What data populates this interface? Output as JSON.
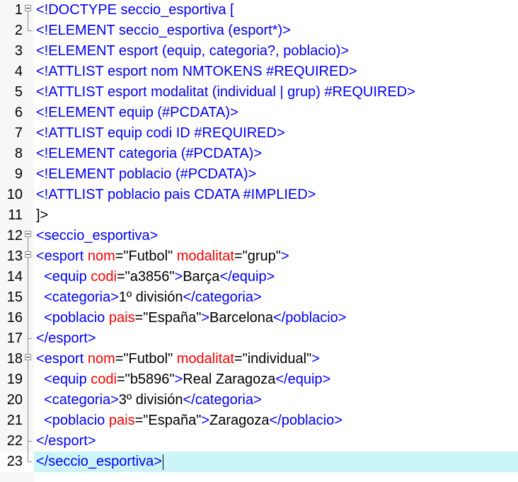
{
  "editor": {
    "current_line": 23,
    "lines": [
      {
        "num": "1",
        "fold": "box",
        "tokens": [
          [
            "tag",
            "<!DOCTYPE seccio_esportiva ["
          ]
        ]
      },
      {
        "num": "2",
        "fold": "end",
        "tokens": [
          [
            "tag",
            "<!ELEMENT seccio_esportiva (esport*)>"
          ]
        ]
      },
      {
        "num": "3",
        "fold": "",
        "tokens": [
          [
            "tag",
            "<!ELEMENT esport (equip, categoria?, poblacio)>"
          ]
        ]
      },
      {
        "num": "4",
        "fold": "",
        "tokens": [
          [
            "tag",
            "<!ATTLIST esport nom NMTOKENS #REQUIRED>"
          ]
        ]
      },
      {
        "num": "5",
        "fold": "",
        "tokens": [
          [
            "tag",
            "<!ATTLIST esport modalitat (individual | grup) #REQUIRED>"
          ]
        ]
      },
      {
        "num": "6",
        "fold": "",
        "tokens": [
          [
            "tag",
            "<!ELEMENT equip (#PCDATA)>"
          ]
        ]
      },
      {
        "num": "7",
        "fold": "",
        "tokens": [
          [
            "tag",
            "<!ATTLIST equip codi ID #REQUIRED>"
          ]
        ]
      },
      {
        "num": "8",
        "fold": "",
        "tokens": [
          [
            "tag",
            "<!ELEMENT categoria (#PCDATA)>"
          ]
        ]
      },
      {
        "num": "9",
        "fold": "",
        "tokens": [
          [
            "tag",
            "<!ELEMENT poblacio (#PCDATA)>"
          ]
        ]
      },
      {
        "num": "10",
        "fold": "",
        "tokens": [
          [
            "tag",
            "<!ATTLIST poblacio pais CDATA #IMPLIED>"
          ]
        ]
      },
      {
        "num": "11",
        "fold": "",
        "tokens": [
          [
            "text",
            "]>"
          ]
        ]
      },
      {
        "num": "12",
        "fold": "box",
        "tokens": [
          [
            "tag",
            "<seccio_esportiva>"
          ]
        ]
      },
      {
        "num": "13",
        "fold": "box",
        "tokens": [
          [
            "tag",
            "<esport "
          ],
          [
            "attr",
            "nom"
          ],
          [
            "val",
            "=\"Futbol\" "
          ],
          [
            "attr",
            "modalitat"
          ],
          [
            "val",
            "=\"grup\""
          ],
          [
            "tag",
            ">"
          ]
        ]
      },
      {
        "num": "14",
        "fold": "mid",
        "tokens": [
          [
            "text",
            "  "
          ],
          [
            "tag",
            "<equip "
          ],
          [
            "attr",
            "codi"
          ],
          [
            "val",
            "=\"a3856\""
          ],
          [
            "tag",
            ">"
          ],
          [
            "text",
            "Barça"
          ],
          [
            "tag",
            "</equip>"
          ]
        ]
      },
      {
        "num": "15",
        "fold": "mid",
        "tokens": [
          [
            "text",
            "  "
          ],
          [
            "tag",
            "<categoria>"
          ],
          [
            "text",
            "1º división"
          ],
          [
            "tag",
            "</categoria>"
          ]
        ]
      },
      {
        "num": "16",
        "fold": "mid",
        "tokens": [
          [
            "text",
            "  "
          ],
          [
            "tag",
            "<poblacio "
          ],
          [
            "attr",
            "pais"
          ],
          [
            "val",
            "=\"España\""
          ],
          [
            "tag",
            ">"
          ],
          [
            "text",
            "Barcelona"
          ],
          [
            "tag",
            "</poblacio>"
          ]
        ]
      },
      {
        "num": "17",
        "fold": "sub",
        "tokens": [
          [
            "tag",
            "</esport>"
          ]
        ]
      },
      {
        "num": "18",
        "fold": "box2",
        "tokens": [
          [
            "tag",
            "<esport "
          ],
          [
            "attr",
            "nom"
          ],
          [
            "val",
            "=\"Futbol\" "
          ],
          [
            "attr",
            "modalitat"
          ],
          [
            "val",
            "=\"individual\""
          ],
          [
            "tag",
            ">"
          ]
        ]
      },
      {
        "num": "19",
        "fold": "mid",
        "tokens": [
          [
            "text",
            "  "
          ],
          [
            "tag",
            "<equip "
          ],
          [
            "attr",
            "codi"
          ],
          [
            "val",
            "=\"b5896\""
          ],
          [
            "tag",
            ">"
          ],
          [
            "text",
            "Real Zaragoza"
          ],
          [
            "tag",
            "</equip>"
          ]
        ]
      },
      {
        "num": "20",
        "fold": "mid",
        "tokens": [
          [
            "text",
            "  "
          ],
          [
            "tag",
            "<categoria>"
          ],
          [
            "text",
            "3º división"
          ],
          [
            "tag",
            "</categoria>"
          ]
        ]
      },
      {
        "num": "21",
        "fold": "mid",
        "tokens": [
          [
            "text",
            "  "
          ],
          [
            "tag",
            "<poblacio "
          ],
          [
            "attr",
            "pais"
          ],
          [
            "val",
            "=\"España\""
          ],
          [
            "tag",
            ">"
          ],
          [
            "text",
            "Zaragoza"
          ],
          [
            "tag",
            "</poblacio>"
          ]
        ]
      },
      {
        "num": "22",
        "fold": "sub",
        "tokens": [
          [
            "tag",
            "</esport>"
          ]
        ]
      },
      {
        "num": "23",
        "fold": "end",
        "tokens": [
          [
            "tag",
            "</seccio_esportiva>"
          ]
        ]
      }
    ]
  },
  "colors": {
    "tag": "#0000ff",
    "attribute": "#ff0000",
    "text": "#000000",
    "current_line_highlight": "#ccf5fa",
    "gutter": "#f7f7f7"
  },
  "icons": {
    "fold_marker": "fold-minus-icon",
    "fold_end": "fold-end-icon"
  }
}
